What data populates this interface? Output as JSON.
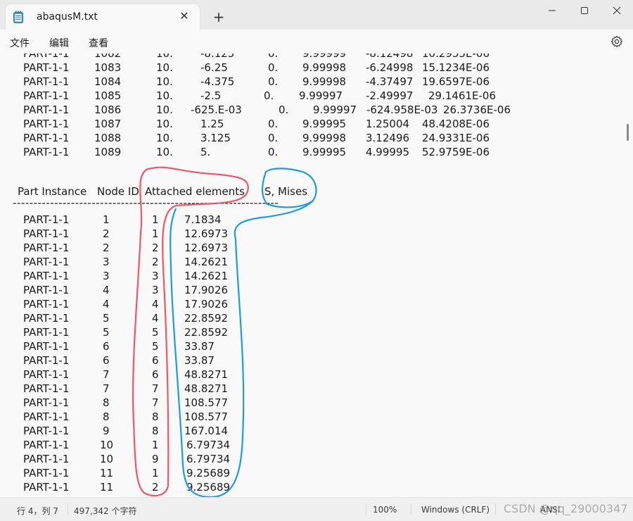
{
  "window": {
    "tab_title": "abaqusM.txt",
    "tab_close": "✕",
    "new_tab": "+"
  },
  "menu": [
    "文件",
    "编辑",
    "查看"
  ],
  "upper_rows": [
    [
      "PART-1-1",
      "1082",
      "10.",
      "-8.125",
      "0.",
      "9.99999",
      "-8.12498",
      "10.2955E-06"
    ],
    [
      "PART-1-1",
      "1083",
      "10.",
      "-6.25",
      "0.",
      "9.99998",
      "-6.24998",
      "15.1234E-06"
    ],
    [
      "PART-1-1",
      "1084",
      "10.",
      "-4.375",
      "0.",
      "9.99998",
      "-4.37497",
      "19.6597E-06"
    ],
    [
      "PART-1-1",
      "1085",
      "10.",
      "-2.5",
      "0.",
      "9.99997",
      "-2.49997",
      "29.1461E-06"
    ],
    [
      "PART-1-1",
      "1086",
      "10.",
      "-625.E-03",
      "0.",
      "9.99997",
      "-624.958E-03",
      "26.3736E-06"
    ],
    [
      "PART-1-1",
      "1087",
      "10.",
      "1.25",
      "0.",
      "9.99995",
      "1.25004",
      "48.4208E-06"
    ],
    [
      "PART-1-1",
      "1088",
      "10.",
      "3.125",
      "0.",
      "9.99998",
      "3.12496",
      "24.9331E-06"
    ],
    [
      "PART-1-1",
      "1089",
      "10.",
      "5.",
      "0.",
      "9.99995",
      "4.99995",
      "52.9759E-06"
    ]
  ],
  "table_headers": [
    "Part Instance",
    "Node ID",
    "Attached elements",
    "S, Mises"
  ],
  "separator": "----------------------------------------------------------------------",
  "lower_rows": [
    [
      "PART-1-1",
      "1",
      "1",
      "7.1834"
    ],
    [
      "PART-1-1",
      "2",
      "1",
      "12.6973"
    ],
    [
      "PART-1-1",
      "2",
      "2",
      "12.6973"
    ],
    [
      "PART-1-1",
      "3",
      "2",
      "14.2621"
    ],
    [
      "PART-1-1",
      "3",
      "3",
      "14.2621"
    ],
    [
      "PART-1-1",
      "4",
      "3",
      "17.9026"
    ],
    [
      "PART-1-1",
      "4",
      "4",
      "17.9026"
    ],
    [
      "PART-1-1",
      "5",
      "4",
      "22.8592"
    ],
    [
      "PART-1-1",
      "5",
      "5",
      "22.8592"
    ],
    [
      "PART-1-1",
      "6",
      "5",
      "33.87"
    ],
    [
      "PART-1-1",
      "6",
      "6",
      "33.87"
    ],
    [
      "PART-1-1",
      "7",
      "6",
      "48.8271"
    ],
    [
      "PART-1-1",
      "7",
      "7",
      "48.8271"
    ],
    [
      "PART-1-1",
      "8",
      "7",
      "108.577"
    ],
    [
      "PART-1-1",
      "8",
      "8",
      "108.577"
    ],
    [
      "PART-1-1",
      "9",
      "8",
      "167.014"
    ],
    [
      "PART-1-1",
      "10",
      "1",
      "6.79734"
    ],
    [
      "PART-1-1",
      "10",
      "9",
      "6.79734"
    ],
    [
      "PART-1-1",
      "11",
      "1",
      "9.25689"
    ],
    [
      "PART-1-1",
      "11",
      "2",
      "9.25689"
    ]
  ],
  "status": {
    "cursor": "行 4，列 7",
    "chars": "497,342 个字符",
    "zoom": "100%",
    "line_endings": "Windows (CRLF)",
    "encoding": "ANSI"
  },
  "watermark": "CSDN @qq_29000347",
  "colors": {
    "annotation_red": "#f0566a",
    "annotation_blue": "#1e9be8"
  },
  "icons": [
    "notepad-icon",
    "close-icon",
    "plus-icon",
    "minimize-icon",
    "maximize-icon",
    "gear-icon"
  ]
}
